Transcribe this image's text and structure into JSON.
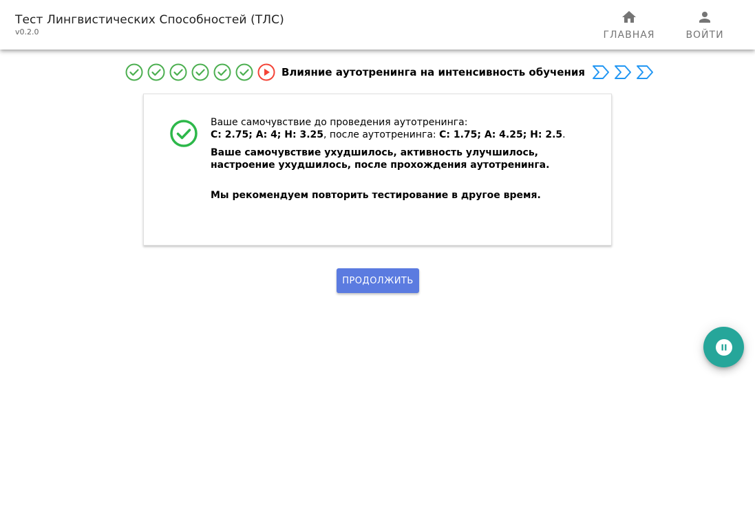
{
  "header": {
    "title": "Тест Лингвистических Способностей (ТЛС)",
    "version": "v0.2.0",
    "nav": {
      "home_label": "ГЛАВНАЯ",
      "home_icon": "home-icon",
      "login_label": "ВОЙТИ",
      "login_icon": "person-icon"
    }
  },
  "stepper": {
    "completed_steps": 6,
    "current_step_title": "Влияние аутотренинга на интенсивность обучения",
    "upcoming_steps": 3,
    "colors": {
      "done": "#4caf50",
      "current": "#f44336",
      "upcoming": "#2196f3"
    }
  },
  "result": {
    "icon": "check-circle-icon",
    "icon_color": "#2db84a",
    "before_intro": "Ваше самочувствие до проведения аутотренинга:",
    "before_values": "С: 2.75; А: 4; Н: 3.25",
    "after_intro": ", после аутотренинга: ",
    "after_values": "С: 1.75; А: 4.25; Н: 2.5",
    "after_end": ".",
    "summary": "Ваше самочувствие ухудшилось, активность улучшилось, настроение ухудшилось, после прохождения аутотренинга.",
    "recommendation": "Мы рекомендуем повторить тестирование в другое время."
  },
  "continue_button": {
    "label": "ПРОДОЛЖИТЬ",
    "color": "#5b7be0"
  },
  "fab": {
    "icon": "pause-icon",
    "color": "#26a69a"
  }
}
